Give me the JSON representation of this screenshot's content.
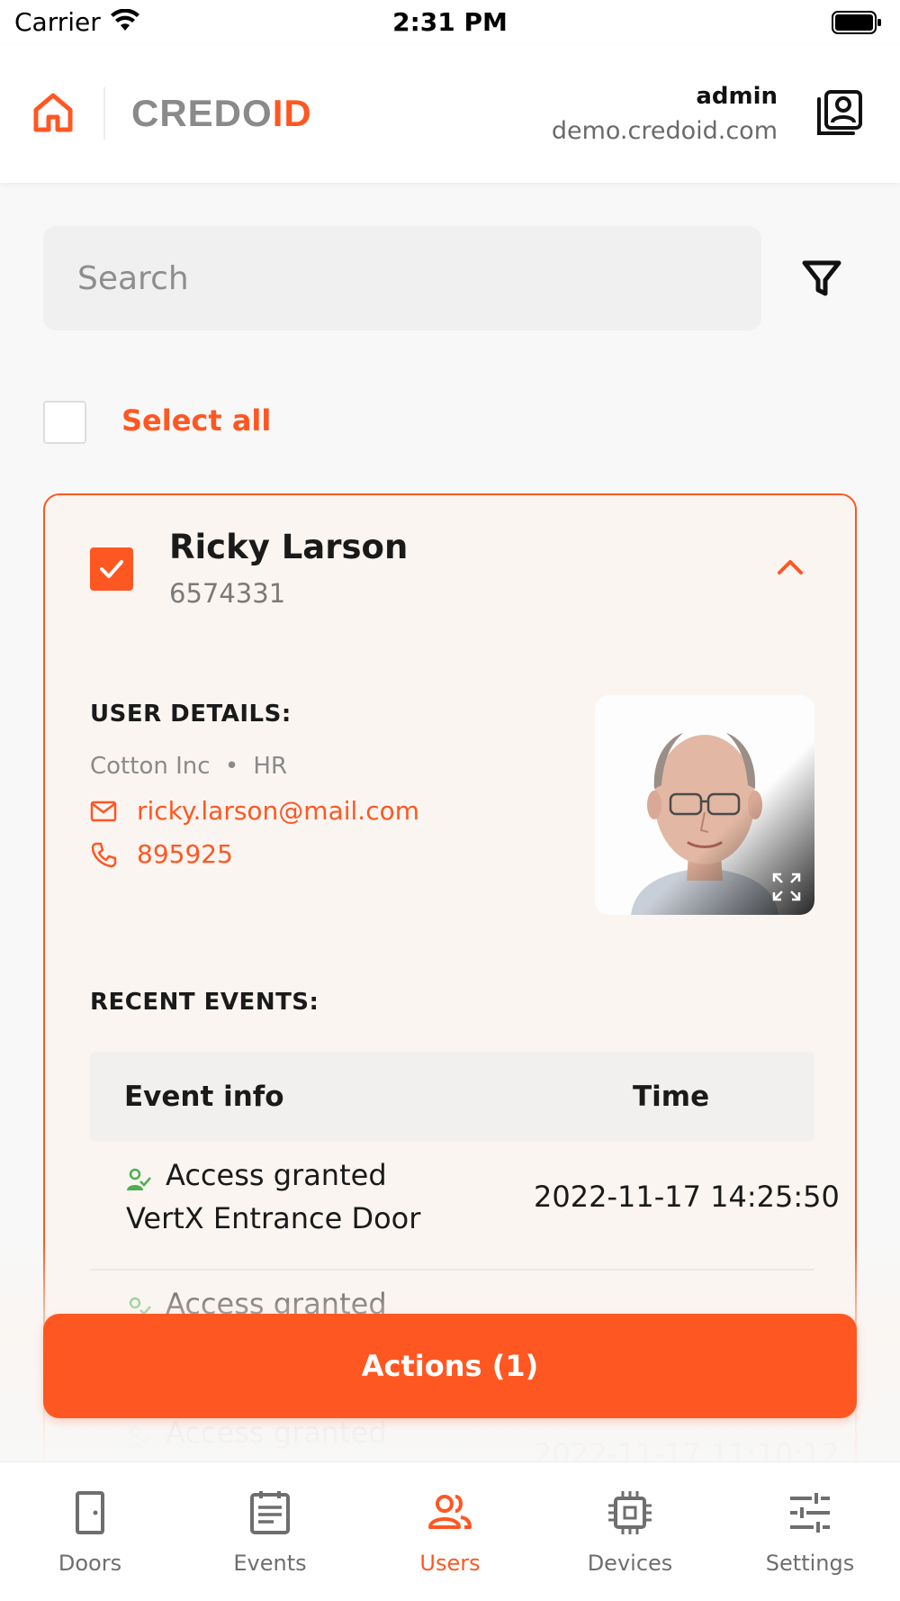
{
  "status_bar": {
    "carrier": "Carrier",
    "time": "2:31 PM"
  },
  "header": {
    "logo_part1": "CREDO",
    "logo_part2": "ID",
    "user_name": "admin",
    "user_domain": "demo.credoid.com"
  },
  "search": {
    "placeholder": "Search",
    "value": ""
  },
  "select_all": {
    "label": "Select all",
    "checked": false
  },
  "user_card": {
    "name": "Ricky Larson",
    "id": "6574331",
    "checked": true,
    "details_title": "USER DETAILS:",
    "company": "Cotton Inc",
    "separator": "•",
    "department": "HR",
    "email": "ricky.larson@mail.com",
    "phone": "895925",
    "events_title": "RECENT EVENTS:",
    "events_table": {
      "headers": {
        "info": "Event info",
        "time": "Time"
      },
      "rows": [
        {
          "status": "Access granted",
          "door": "VertX Entrance Door",
          "time": "2022-11-17 14:25:50"
        },
        {
          "status": "Access granted",
          "door": "",
          "time": ""
        },
        {
          "status": "Access granted",
          "door": "",
          "time": "2022-11-17 11:10:12"
        }
      ]
    }
  },
  "actions_button": {
    "label": "Actions (1)"
  },
  "tabs": [
    {
      "label": "Doors",
      "icon": "door-icon",
      "active": false
    },
    {
      "label": "Events",
      "icon": "events-icon",
      "active": false
    },
    {
      "label": "Users",
      "icon": "users-icon",
      "active": true
    },
    {
      "label": "Devices",
      "icon": "chip-icon",
      "active": false
    },
    {
      "label": "Settings",
      "icon": "sliders-icon",
      "active": false
    }
  ],
  "colors": {
    "accent": "#ff5722",
    "granted": "#4caf50",
    "card_bg": "#faf5f1"
  }
}
